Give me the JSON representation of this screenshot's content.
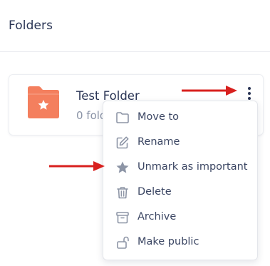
{
  "header": {
    "title": "Folders"
  },
  "folder": {
    "name": "Test Folder",
    "subtitle": "0 folders",
    "icon": "folder-star-icon",
    "color": "#f47f5e"
  },
  "menu": {
    "items": [
      {
        "label": "Move to",
        "icon": "folder-icon"
      },
      {
        "label": "Rename",
        "icon": "pencil-square-icon"
      },
      {
        "label": "Unmark as important",
        "icon": "star-icon"
      },
      {
        "label": "Delete",
        "icon": "trash-icon"
      },
      {
        "label": "Archive",
        "icon": "archive-box-icon"
      },
      {
        "label": "Make public",
        "icon": "unlock-icon"
      }
    ]
  },
  "colors": {
    "text": "#2a3555",
    "muted": "#8a93a6",
    "menu_icon": "#8d95a6",
    "annotation_arrow": "#d8201e"
  }
}
